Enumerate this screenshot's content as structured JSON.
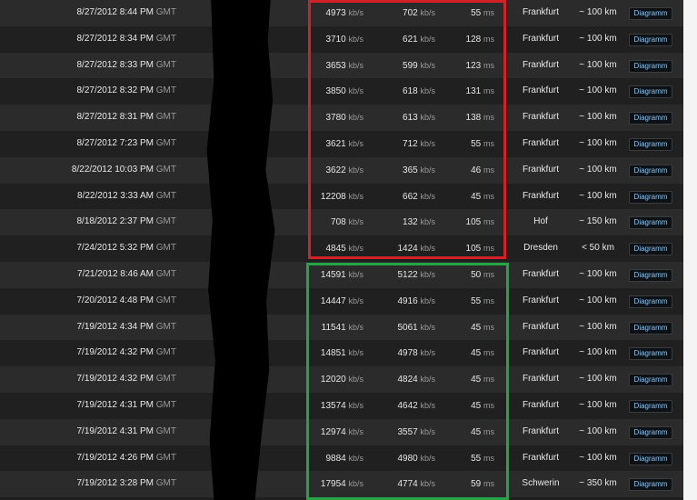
{
  "results": {
    "rows": [
      {
        "date": "8/27/2012 8:44 PM",
        "tz": "GMT",
        "download": "4973",
        "download_unit": "kb/s",
        "upload": "702",
        "upload_unit": "kb/s",
        "ping": "55",
        "ping_unit": "ms",
        "city": "Frankfurt",
        "distance": "~ 100 km",
        "button": "Diagramm"
      },
      {
        "date": "8/27/2012 8:34 PM",
        "tz": "GMT",
        "download": "3710",
        "download_unit": "kb/s",
        "upload": "621",
        "upload_unit": "kb/s",
        "ping": "128",
        "ping_unit": "ms",
        "city": "Frankfurt",
        "distance": "~ 100 km",
        "button": "Diagramm"
      },
      {
        "date": "8/27/2012 8:33 PM",
        "tz": "GMT",
        "download": "3653",
        "download_unit": "kb/s",
        "upload": "599",
        "upload_unit": "kb/s",
        "ping": "123",
        "ping_unit": "ms",
        "city": "Frankfurt",
        "distance": "~ 100 km",
        "button": "Diagramm"
      },
      {
        "date": "8/27/2012 8:32 PM",
        "tz": "GMT",
        "download": "3850",
        "download_unit": "kb/s",
        "upload": "618",
        "upload_unit": "kb/s",
        "ping": "131",
        "ping_unit": "ms",
        "city": "Frankfurt",
        "distance": "~ 100 km",
        "button": "Diagramm"
      },
      {
        "date": "8/27/2012 8:31 PM",
        "tz": "GMT",
        "download": "3780",
        "download_unit": "kb/s",
        "upload": "613",
        "upload_unit": "kb/s",
        "ping": "138",
        "ping_unit": "ms",
        "city": "Frankfurt",
        "distance": "~ 100 km",
        "button": "Diagramm"
      },
      {
        "date": "8/27/2012 7:23 PM",
        "tz": "GMT",
        "download": "3621",
        "download_unit": "kb/s",
        "upload": "712",
        "upload_unit": "kb/s",
        "ping": "55",
        "ping_unit": "ms",
        "city": "Frankfurt",
        "distance": "~ 100 km",
        "button": "Diagramm"
      },
      {
        "date": "8/22/2012 10:03 PM",
        "tz": "GMT",
        "download": "3622",
        "download_unit": "kb/s",
        "upload": "365",
        "upload_unit": "kb/s",
        "ping": "46",
        "ping_unit": "ms",
        "city": "Frankfurt",
        "distance": "~ 100 km",
        "button": "Diagramm"
      },
      {
        "date": "8/22/2012 3:33 AM",
        "tz": "GMT",
        "download": "12208",
        "download_unit": "kb/s",
        "upload": "662",
        "upload_unit": "kb/s",
        "ping": "45",
        "ping_unit": "ms",
        "city": "Frankfurt",
        "distance": "~ 100 km",
        "button": "Diagramm"
      },
      {
        "date": "8/18/2012 2:37 PM",
        "tz": "GMT",
        "download": "708",
        "download_unit": "kb/s",
        "upload": "132",
        "upload_unit": "kb/s",
        "ping": "105",
        "ping_unit": "ms",
        "city": "Hof",
        "distance": "~ 150 km",
        "button": "Diagramm"
      },
      {
        "date": "7/24/2012 5:32 PM",
        "tz": "GMT",
        "download": "4845",
        "download_unit": "kb/s",
        "upload": "1424",
        "upload_unit": "kb/s",
        "ping": "105",
        "ping_unit": "ms",
        "city": "Dresden",
        "distance": "< 50 km",
        "button": "Diagramm"
      },
      {
        "date": "7/21/2012 8:46 AM",
        "tz": "GMT",
        "download": "14591",
        "download_unit": "kb/s",
        "upload": "5122",
        "upload_unit": "kb/s",
        "ping": "50",
        "ping_unit": "ms",
        "city": "Frankfurt",
        "distance": "~ 100 km",
        "button": "Diagramm"
      },
      {
        "date": "7/20/2012 4:48 PM",
        "tz": "GMT",
        "download": "14447",
        "download_unit": "kb/s",
        "upload": "4916",
        "upload_unit": "kb/s",
        "ping": "55",
        "ping_unit": "ms",
        "city": "Frankfurt",
        "distance": "~ 100 km",
        "button": "Diagramm"
      },
      {
        "date": "7/19/2012 4:34 PM",
        "tz": "GMT",
        "download": "11541",
        "download_unit": "kb/s",
        "upload": "5061",
        "upload_unit": "kb/s",
        "ping": "45",
        "ping_unit": "ms",
        "city": "Frankfurt",
        "distance": "~ 100 km",
        "button": "Diagramm"
      },
      {
        "date": "7/19/2012 4:32 PM",
        "tz": "GMT",
        "download": "14851",
        "download_unit": "kb/s",
        "upload": "4978",
        "upload_unit": "kb/s",
        "ping": "45",
        "ping_unit": "ms",
        "city": "Frankfurt",
        "distance": "~ 100 km",
        "button": "Diagramm"
      },
      {
        "date": "7/19/2012 4:32 PM",
        "tz": "GMT",
        "download": "12020",
        "download_unit": "kb/s",
        "upload": "4824",
        "upload_unit": "kb/s",
        "ping": "45",
        "ping_unit": "ms",
        "city": "Frankfurt",
        "distance": "~ 100 km",
        "button": "Diagramm"
      },
      {
        "date": "7/19/2012 4:31 PM",
        "tz": "GMT",
        "download": "13574",
        "download_unit": "kb/s",
        "upload": "4642",
        "upload_unit": "kb/s",
        "ping": "45",
        "ping_unit": "ms",
        "city": "Frankfurt",
        "distance": "~ 100 km",
        "button": "Diagramm"
      },
      {
        "date": "7/19/2012 4:31 PM",
        "tz": "GMT",
        "download": "12974",
        "download_unit": "kb/s",
        "upload": "3557",
        "upload_unit": "kb/s",
        "ping": "45",
        "ping_unit": "ms",
        "city": "Frankfurt",
        "distance": "~ 100 km",
        "button": "Diagramm"
      },
      {
        "date": "7/19/2012 4:26 PM",
        "tz": "GMT",
        "download": "9884",
        "download_unit": "kb/s",
        "upload": "4980",
        "upload_unit": "kb/s",
        "ping": "55",
        "ping_unit": "ms",
        "city": "Frankfurt",
        "distance": "~ 100 km",
        "button": "Diagramm"
      },
      {
        "date": "7/19/2012 3:28 PM",
        "tz": "GMT",
        "download": "17954",
        "download_unit": "kb/s",
        "upload": "4774",
        "upload_unit": "kb/s",
        "ping": "59",
        "ping_unit": "ms",
        "city": "Schwerin",
        "distance": "~ 350 km",
        "button": "Diagramm"
      }
    ]
  },
  "colors": {
    "red_highlight": "#d42027",
    "green_highlight": "#23a547",
    "button_text": "#8ec6f0",
    "row_even": "#2b2b2b",
    "row_odd": "#202020"
  }
}
